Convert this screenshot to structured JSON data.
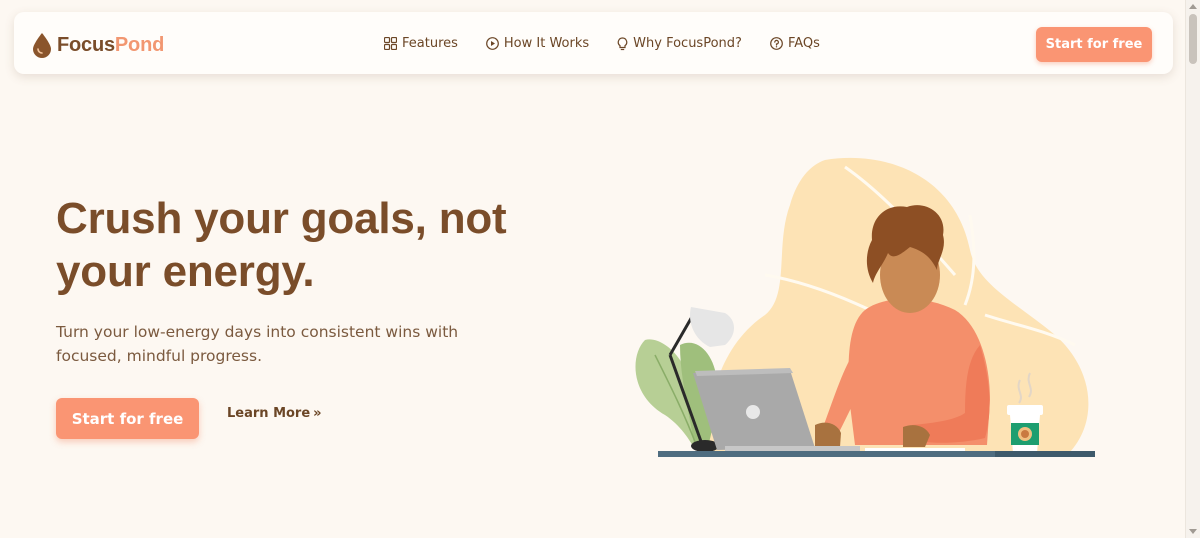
{
  "brand": {
    "name_part1": "Focus",
    "name_part2": "Pond"
  },
  "nav": {
    "items": [
      {
        "label": "Features",
        "icon": "grid-icon"
      },
      {
        "label": "How It Works",
        "icon": "play-circle-icon"
      },
      {
        "label": "Why FocusPond?",
        "icon": "lightbulb-icon"
      },
      {
        "label": "FAQs",
        "icon": "question-circle-icon"
      }
    ],
    "cta_label": "Start for free"
  },
  "hero": {
    "title": "Crush your goals, not your energy.",
    "subtitle": "Turn your low-energy days into consistent wins with focused, mindful progress.",
    "cta_label": "Start for free",
    "secondary_label": "Learn More",
    "secondary_icon": "double-chevron-right-icon"
  },
  "colors": {
    "accent": "#fa9573",
    "brand_brown": "#7a4d2a",
    "background": "#fdf8f2"
  }
}
